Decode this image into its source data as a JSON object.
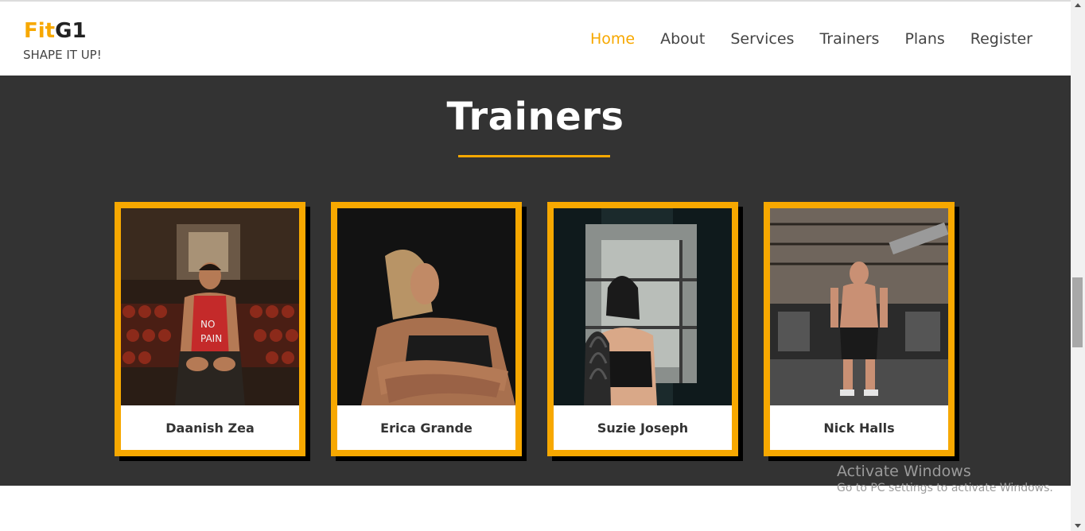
{
  "header": {
    "logo_part1": "Fit",
    "logo_part2": "G1",
    "tagline": "SHAPE IT UP!",
    "nav": [
      {
        "label": "Home",
        "active": true
      },
      {
        "label": "About",
        "active": false
      },
      {
        "label": "Services",
        "active": false
      },
      {
        "label": "Trainers",
        "active": false
      },
      {
        "label": "Plans",
        "active": false
      },
      {
        "label": "Register",
        "active": false
      }
    ]
  },
  "trainers": {
    "title": "Trainers",
    "cards": [
      {
        "name": "Daanish Zea",
        "photo": "trainer-photo-daanish"
      },
      {
        "name": "Erica Grande",
        "photo": "trainer-photo-erica"
      },
      {
        "name": "Suzie Joseph",
        "photo": "trainer-photo-suzie"
      },
      {
        "name": "Nick Halls",
        "photo": "trainer-photo-nick"
      }
    ]
  },
  "watermark": {
    "title": "Activate Windows",
    "subtitle": "Go to PC settings to activate Windows."
  },
  "colors": {
    "accent": "#f7a800",
    "section_bg": "#333333",
    "text_dark": "#444444"
  }
}
